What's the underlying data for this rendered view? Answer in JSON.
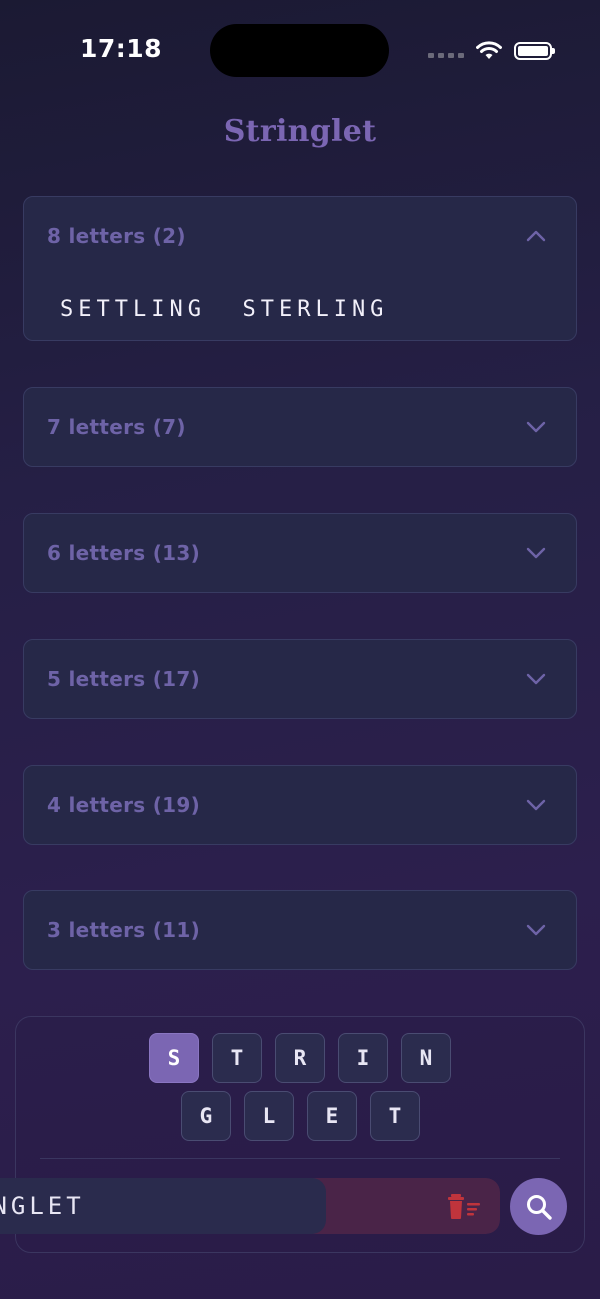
{
  "status_bar": {
    "time": "17:18"
  },
  "app": {
    "title": "Stringlet"
  },
  "sections": [
    {
      "label": "8 letters (2)",
      "expanded": true,
      "words": [
        "SETTLING",
        "STERLING"
      ]
    },
    {
      "label": "7 letters (7)",
      "expanded": false
    },
    {
      "label": "6 letters (13)",
      "expanded": false
    },
    {
      "label": "5 letters (17)",
      "expanded": false
    },
    {
      "label": "4 letters (19)",
      "expanded": false
    },
    {
      "label": "3 letters (11)",
      "expanded": false
    }
  ],
  "letters": {
    "row1": [
      {
        "char": "S",
        "selected": true
      },
      {
        "char": "T",
        "selected": false
      },
      {
        "char": "R",
        "selected": false
      },
      {
        "char": "I",
        "selected": false
      },
      {
        "char": "N",
        "selected": false
      }
    ],
    "row2": [
      {
        "char": "G",
        "selected": false
      },
      {
        "char": "L",
        "selected": false
      },
      {
        "char": "E",
        "selected": false
      },
      {
        "char": "T",
        "selected": false
      }
    ]
  },
  "input": {
    "value": "INGLET"
  },
  "icons": {
    "clear": "trash-icon",
    "search": "search-icon",
    "collapse": "chevron-up-icon",
    "expand": "chevron-down-icon"
  },
  "colors": {
    "accent": "#7b66b3",
    "section_label": "#6e63a7",
    "clear_red": "#c0343c"
  }
}
